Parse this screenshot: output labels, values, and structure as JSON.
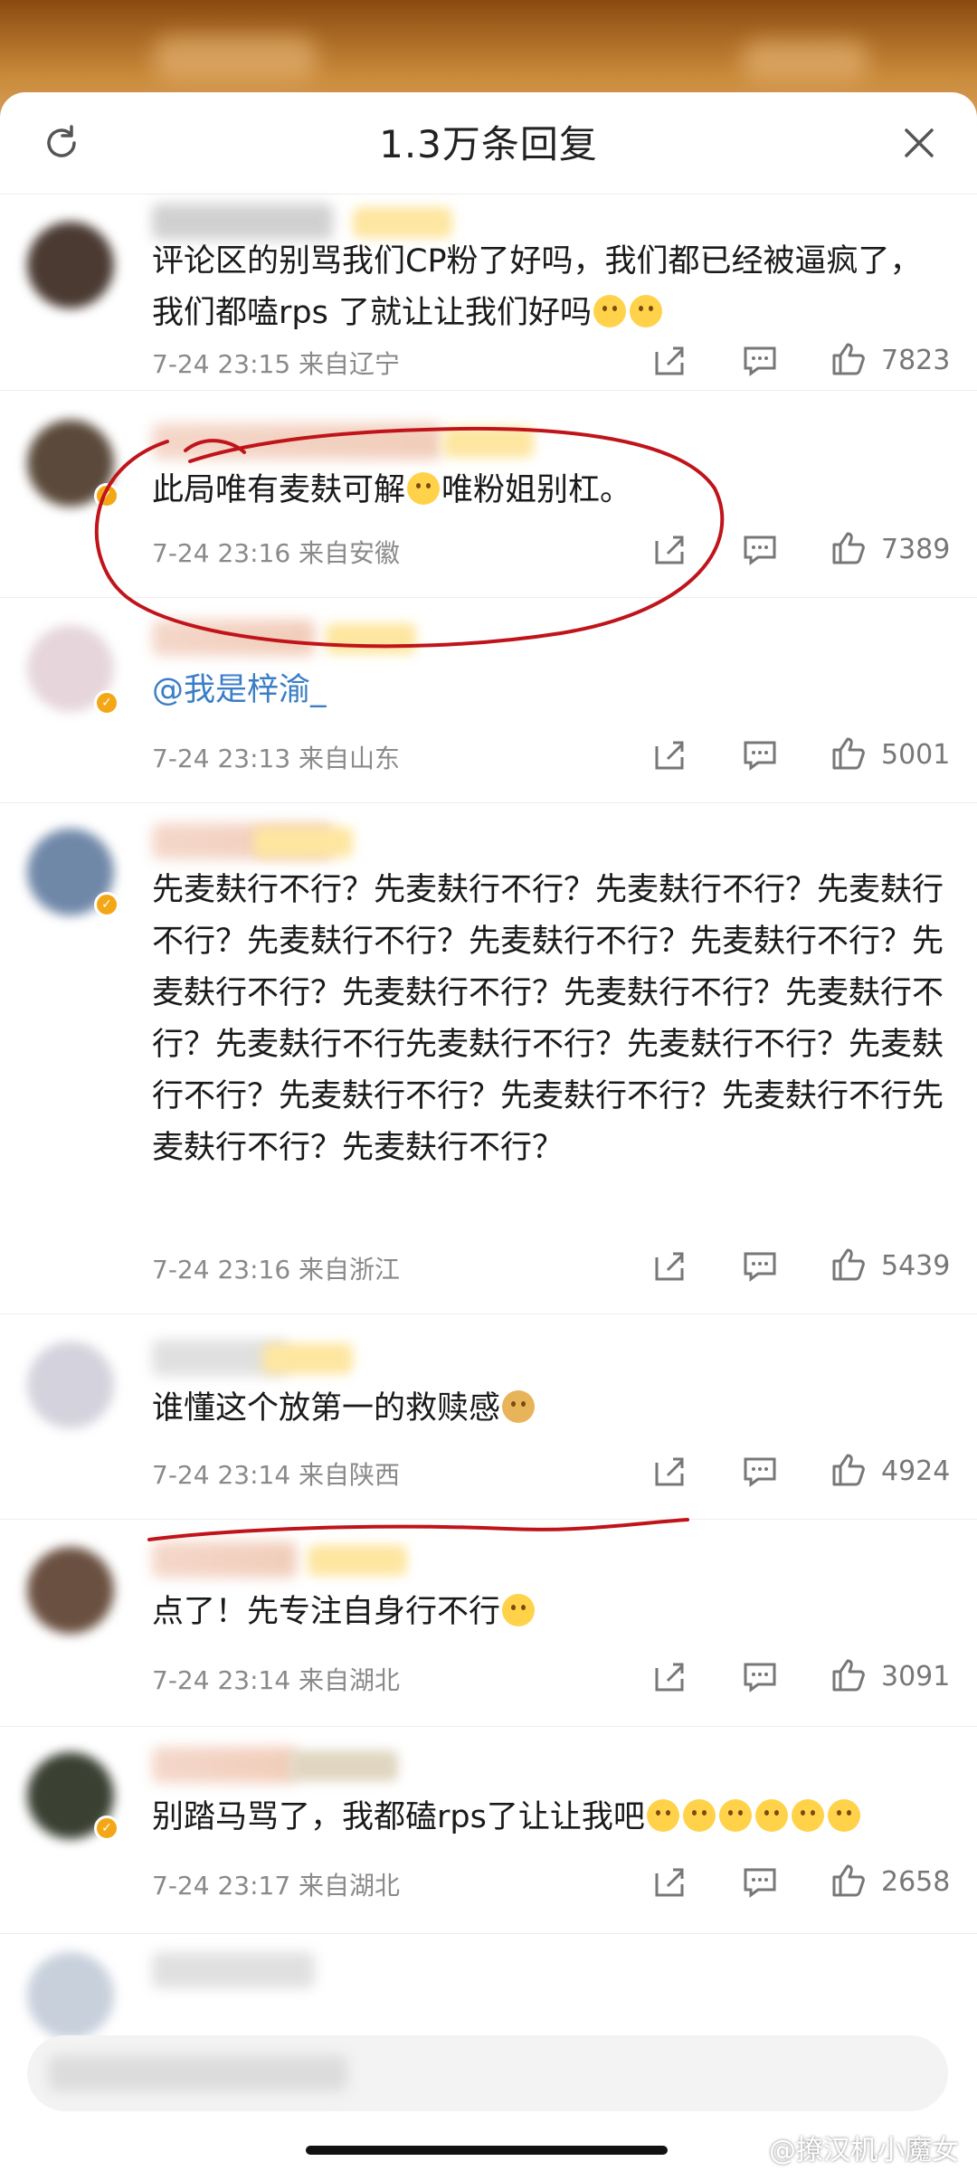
{
  "header": {
    "title": "1.3万条回复"
  },
  "comments": [
    {
      "text": "评论区的别骂我们CP粉了好吗，我们都已经被逼疯了，我们都嗑rps 了就让让我们好吗",
      "emoji_count": 2,
      "time": "7-24 23:15",
      "location": "来自辽宁",
      "likes": "7823"
    },
    {
      "text": "此局唯有麦麸可解",
      "text2": "唯粉姐别杠。",
      "time": "7-24 23:16",
      "location": "来自安徽",
      "likes": "7389"
    },
    {
      "text": "@我是梓渝_",
      "time": "7-24 23:13",
      "location": "来自山东",
      "likes": "5001"
    },
    {
      "text": "先麦麸行不行？先麦麸行不行？先麦麸行不行？先麦麸行不行？先麦麸行不行？先麦麸行不行？先麦麸行不行？先麦麸行不行？先麦麸行不行？先麦麸行不行？先麦麸行不行？先麦麸行不行先麦麸行不行？先麦麸行不行？先麦麸行不行？先麦麸行不行？先麦麸行不行？先麦麸行不行先麦麸行不行？先麦麸行不行？",
      "time": "7-24 23:16",
      "location": "来自浙江",
      "likes": "5439"
    },
    {
      "text": "谁懂这个放第一的救赎感",
      "time": "7-24 23:14",
      "location": "来自陕西",
      "likes": "4924"
    },
    {
      "text": "点了！先专注自身行不行",
      "time": "7-24 23:14",
      "location": "来自湖北",
      "likes": "3091"
    },
    {
      "text": "别踏马骂了，我都磕rps了让让我吧",
      "time": "7-24 23:17",
      "location": "来自湖北",
      "likes": "2658"
    }
  ],
  "watermark": "@撩汉机小魔女",
  "colors": {
    "annotation": "#c0141b",
    "link": "#3a7ec6",
    "badge": "#f4a716"
  }
}
